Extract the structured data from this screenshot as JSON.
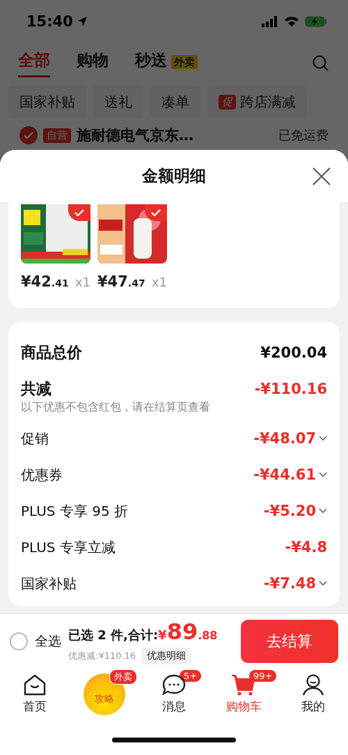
{
  "status_bar": {
    "time": "15:40"
  },
  "top_tabs": [
    {
      "label": "全部",
      "selected": true
    },
    {
      "label": "购物",
      "selected": false
    },
    {
      "label": "秒送",
      "selected": false,
      "badge": "外卖"
    }
  ],
  "filter_chips": [
    {
      "label": "国家补贴"
    },
    {
      "label": "送礼"
    },
    {
      "label": "凑单"
    },
    {
      "label": "跨店满减",
      "tag": "促"
    }
  ],
  "store": {
    "checked": true,
    "tag": "自营",
    "name": "施耐德电气京东…",
    "shipping": "已免运费"
  },
  "sheet": {
    "title": "金额明细",
    "products": [
      {
        "price_int": "¥42",
        "price_dec": ".41",
        "qty": "x1",
        "selected": true,
        "kind": "picture"
      },
      {
        "price_int": "¥47",
        "price_dec": ".47",
        "qty": "x1",
        "selected": true,
        "kind": "picture"
      }
    ],
    "total": {
      "label": "商品总价",
      "value": "¥200.04"
    },
    "discount": {
      "label": "共减",
      "value": "-¥110.16",
      "note": "以下优惠不包含红包，请在结算页查看"
    },
    "items": [
      {
        "label": "促销",
        "value": "-¥48.07",
        "kind": "expandable"
      },
      {
        "label": "优惠券",
        "value": "-¥44.61",
        "kind": "expandable"
      },
      {
        "label": "PLUS 专享 95 折",
        "value": "-¥5.20",
        "kind": "expandable"
      },
      {
        "label": "PLUS 专享立减",
        "value": "-¥4.8",
        "kind": "plain"
      },
      {
        "label": "国家补贴",
        "value": "-¥7.48",
        "kind": "expandable"
      }
    ]
  },
  "checkout": {
    "select_all": {
      "label": "全选",
      "checked": false
    },
    "summary": "已选 2 件,合计:",
    "currency": "¥",
    "amount_int": "89",
    "amount_dec": ".88",
    "saved": "优惠减:¥110.16",
    "details_button": "优惠明细",
    "submit": "去结算"
  },
  "bottom_nav": [
    {
      "label": "首页",
      "kind": "home",
      "selected": false
    },
    {
      "label": "攻略",
      "kind": "promo",
      "badge": "外卖",
      "selected": false
    },
    {
      "label": "消息",
      "kind": "chat",
      "badge": "5+",
      "selected": false
    },
    {
      "label": "购物车",
      "kind": "cart",
      "badge": "99+",
      "selected": true
    },
    {
      "label": "我的",
      "kind": "profile",
      "selected": false
    }
  ]
}
